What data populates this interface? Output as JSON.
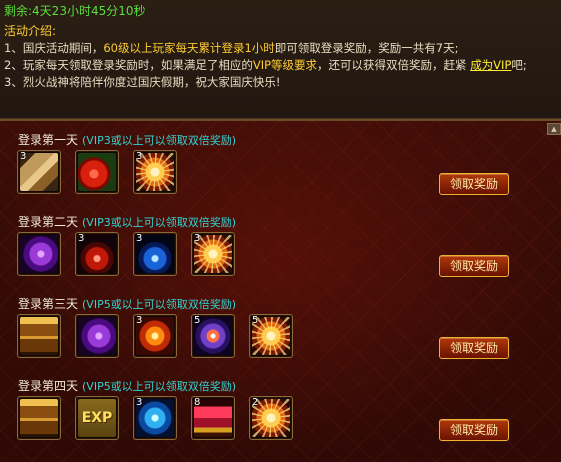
{
  "countdown": "剩余:4天23小时45分10秒",
  "intro": {
    "title": "活动介绍:",
    "line1": {
      "a": "1、国庆活动期间，",
      "b": "60级以上玩家每天累计登录1小时",
      "c": "即可领取登录奖励，奖励一共有7天;"
    },
    "line2": {
      "a": "2、玩家每天领取登录奖励时，如果满足了相应的",
      "b": "VIP等级要求",
      "c": "，还可以获得双倍奖励，赶紧 ",
      "d": "成为VIP",
      "e": "吧;"
    },
    "line3": "3、烈火战神将陪伴你度过国庆假期，祝大家国庆快乐!"
  },
  "days": [
    {
      "title": "登录第一天",
      "subtitle": "(VIP3或以上可以领取双倍奖励)",
      "button": "领取奖励",
      "items": [
        {
          "icon": "card-bundle-icon",
          "qty": "3"
        },
        {
          "icon": "red-fruit-icon",
          "qty": ""
        },
        {
          "icon": "fireworks-icon",
          "qty": "3"
        }
      ]
    },
    {
      "title": "登录第二天",
      "subtitle": "(VIP3或以上可以领取双倍奖励)",
      "button": "领取奖励",
      "items": [
        {
          "icon": "purple-glove-icon",
          "qty": ""
        },
        {
          "icon": "red-potion-icon",
          "qty": "3"
        },
        {
          "icon": "blue-potion-icon",
          "qty": "3"
        },
        {
          "icon": "fireworks-icon",
          "qty": "3"
        }
      ]
    },
    {
      "title": "登录第三天",
      "subtitle": "(VIP5或以上可以领取双倍奖励)",
      "button": "领取奖励",
      "items": [
        {
          "icon": "treasure-chest-icon",
          "qty": ""
        },
        {
          "icon": "purple-glove-icon",
          "qty": ""
        },
        {
          "icon": "fire-orb-icon",
          "qty": "3"
        },
        {
          "icon": "magic-eye-icon",
          "qty": "5"
        },
        {
          "icon": "fireworks-icon",
          "qty": "5"
        }
      ]
    },
    {
      "title": "登录第四天",
      "subtitle": "(VIP5或以上可以领取双倍奖励)",
      "button": "领取奖励",
      "items": [
        {
          "icon": "treasure-chest-icon",
          "qty": ""
        },
        {
          "icon": "exp-scroll-icon",
          "qty": ""
        },
        {
          "icon": "blue-gem-icon",
          "qty": "3"
        },
        {
          "icon": "ruby-treasure-icon",
          "qty": "8"
        },
        {
          "icon": "fireworks-icon",
          "qty": "2"
        }
      ]
    }
  ],
  "exp_label": "EXP"
}
